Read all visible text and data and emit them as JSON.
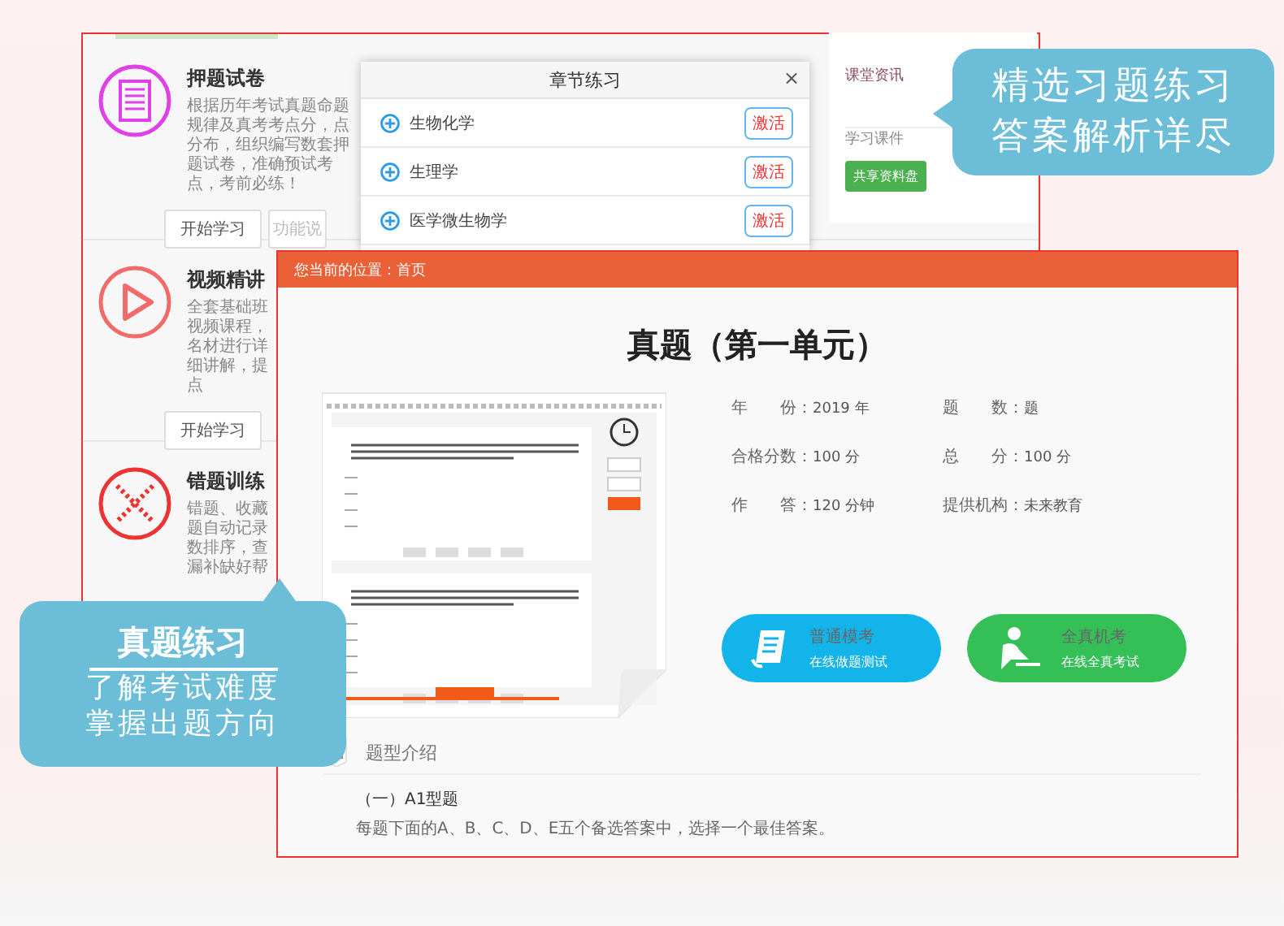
{
  "practice_panel": {
    "items": [
      {
        "kind": "paper",
        "title": "押题试卷",
        "desc": "根据历年考试真题命题规律及真考考点分，点分布，组织编写数套押题试卷，准确预试考点，考前必练！",
        "buttons": [
          {
            "label": "开始学习",
            "disabled": false
          },
          {
            "label": "功能说",
            "disabled": true
          }
        ]
      },
      {
        "kind": "video",
        "title": "视频精讲",
        "desc": "全套基础班视频课程，名材进行详细讲解，提点",
        "buttons": [
          {
            "label": "开始学习",
            "disabled": false
          }
        ]
      },
      {
        "kind": "mistakes",
        "title": "错题训练",
        "desc": "错题、收藏题自动记录数排序，查漏补缺好帮"
      }
    ]
  },
  "sidebar": {
    "links": [
      "课堂资讯",
      "学习课件"
    ],
    "button": "共享资料盘"
  },
  "chapter_dialog": {
    "title": "章节练习",
    "close": "×",
    "chapters": [
      {
        "name": "生物化学",
        "action": "激活"
      },
      {
        "name": "生理学",
        "action": "激活"
      },
      {
        "name": "医学微生物学",
        "action": "激活"
      }
    ]
  },
  "exam_page": {
    "breadcrumb_label": "您当前的位置：",
    "breadcrumb_page": "首页",
    "title": "真题（第一单元）",
    "info": [
      {
        "label": "年　　份：",
        "value": "2019 年"
      },
      {
        "label": "题　　数：",
        "value": "题"
      },
      {
        "label": "合格分数：",
        "value": "100 分"
      },
      {
        "label": "总　　分：",
        "value": "100 分"
      },
      {
        "label": "作　　答：",
        "value": "120 分钟"
      },
      {
        "label": "提供机构：",
        "value": "未来教育"
      }
    ],
    "modes": [
      {
        "kind": "normal",
        "title": "普通模考",
        "subtitle": "在线做题测试",
        "color": "#12b4ea"
      },
      {
        "kind": "real",
        "title": "全真机考",
        "subtitle": "在线全真考试",
        "color": "#35bf57"
      }
    ],
    "section_title": "题型介绍",
    "section_heading": "（一）A1型题",
    "section_text": "每题下面的A、B、C、D、E五个备选答案中，选择一个最佳答案。"
  },
  "callouts": [
    {
      "kind": "right",
      "lines": [
        "精选习题练习",
        "答案解析详尽"
      ]
    },
    {
      "kind": "up",
      "title": "真题练习",
      "lines": [
        "了解考试难度",
        "掌握出题方向"
      ]
    }
  ]
}
